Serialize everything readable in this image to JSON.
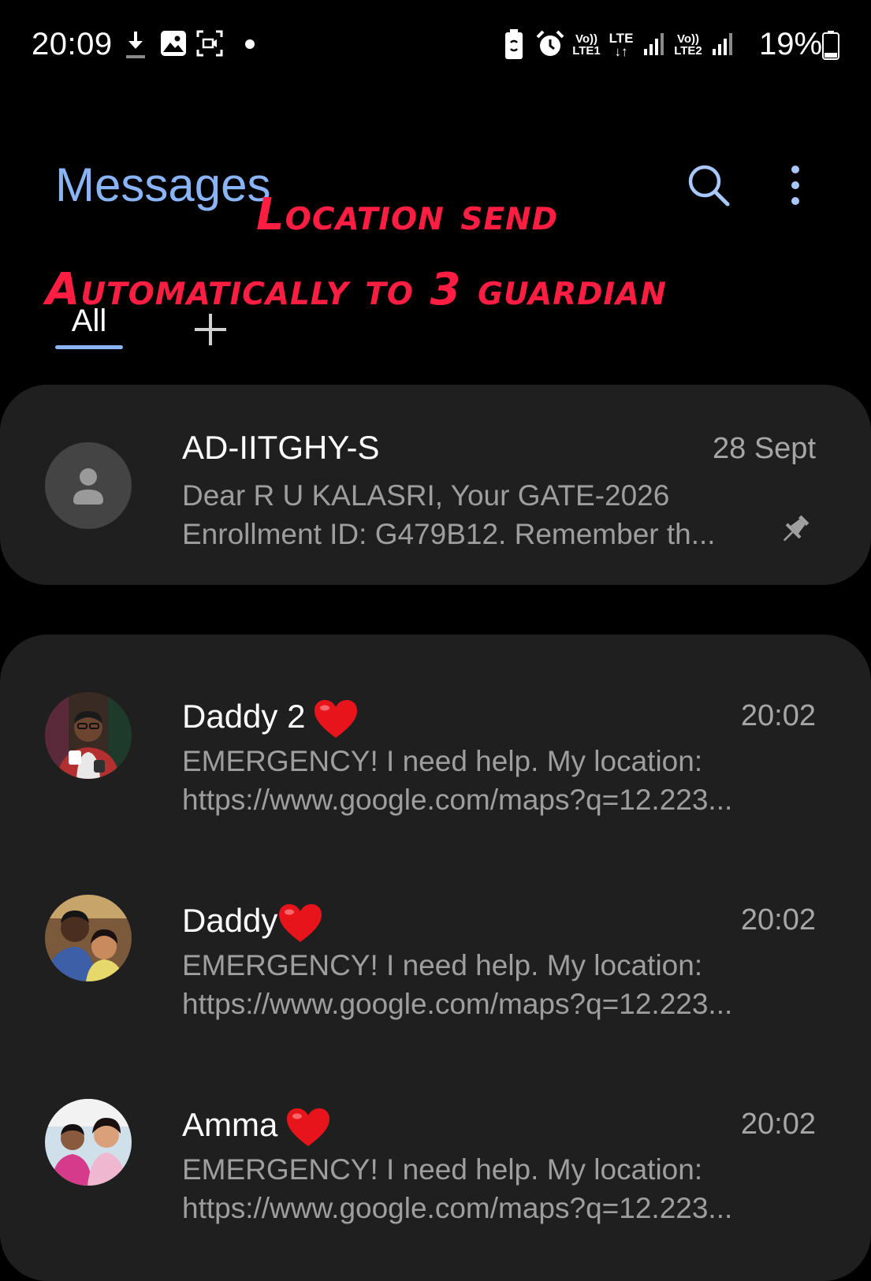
{
  "status_bar": {
    "time": "20:09",
    "net1_top": "Vo))",
    "net1_bottom": "LTE1",
    "data_top": "LTE",
    "data_bottom": "↓↑",
    "net2_top": "Vo))",
    "net2_bottom": "LTE2",
    "battery_percent": "19%",
    "icons": [
      "download-icon",
      "gallery-icon",
      "screen-record-icon",
      "notification-dot-icon",
      "battery-saver-icon",
      "alarm-icon",
      "signal-icon",
      "battery-icon"
    ]
  },
  "header": {
    "title": "Messages",
    "search_icon": "search-icon",
    "more_icon": "more-vert-icon"
  },
  "tabs": {
    "all_label": "All",
    "add_icon": "plus-icon"
  },
  "annotation": {
    "line1": "Location send",
    "line2": "Automatically to 3 guardian",
    "color": "#ff1e42"
  },
  "pinned": {
    "name": "AD-IITGHY-S",
    "time": "28 Sept",
    "preview_line1": "Dear R U KALASRI, Your GATE-2026",
    "preview_line2": "Enrollment ID: G479B12. Remember th...",
    "pinned_icon": "pin-icon"
  },
  "conversations": [
    {
      "name": "Daddy 2",
      "time": "20:02",
      "preview_line1": "EMERGENCY! I need help. My location:",
      "preview_line2": "https://www.google.com/maps?q=12.223..."
    },
    {
      "name": "Daddy",
      "time": "20:02",
      "preview_line1": "EMERGENCY! I need help. My location:",
      "preview_line2": "https://www.google.com/maps?q=12.223..."
    },
    {
      "name": "Amma",
      "time": "20:02",
      "preview_line1": "EMERGENCY! I need help. My location:",
      "preview_line2": "https://www.google.com/maps?q=12.223..."
    }
  ],
  "colors": {
    "background": "#000000",
    "card": "#1f1f1f",
    "title_accent": "#8ab4f8",
    "heart": "#e8141c"
  }
}
